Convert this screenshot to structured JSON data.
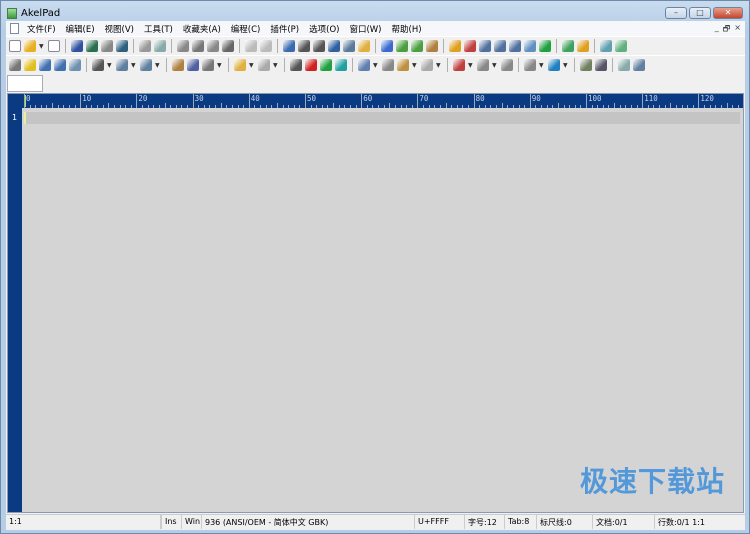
{
  "window": {
    "title": "AkelPad",
    "minimize": "–",
    "maximize": "□",
    "close": "✕"
  },
  "menu": [
    "文件(F)",
    "编辑(E)",
    "视图(V)",
    "工具(T)",
    "收藏夹(A)",
    "编程(C)",
    "插件(P)",
    "选项(O)",
    "窗口(W)",
    "帮助(H)"
  ],
  "mdi": {
    "minimize": "_",
    "restore": "🗗",
    "close": "×"
  },
  "toolbar1": [
    "new-file-icon",
    "open-file-icon|#e8b020",
    "dd",
    "print-preview-icon",
    "sep",
    "save-icon|#3050a0",
    "save-as-icon|#2a7050",
    "save-all-icon|#888",
    "close-file-icon|#306080",
    "sep",
    "print-icon|#999",
    "preview-icon|#8aa",
    "sep",
    "cut-icon|#888",
    "copy-icon|#777",
    "paste-icon|#888",
    "delete-icon|#666",
    "sep",
    "undo-icon|#bbb",
    "redo-icon|#bbb",
    "sep",
    "find-icon|#3a6ab0",
    "find-next-icon|#555",
    "find-prev-icon|#555",
    "replace-icon|#3060a0",
    "goto-icon|#5a7a9a",
    "clipboard-icon|#e0b040",
    "sep",
    "font-icon|#3a6ad0",
    "font-increase-icon|#4aa040",
    "font-decrease-icon|#4aa040",
    "color-icon|#b08040",
    "sep",
    "lock-icon|#e0a020",
    "insert-icon|#c04040",
    "split-icon|#5070a0",
    "split-vertical-icon|#5070a0",
    "split-horizontal-icon|#5070a0",
    "pin-icon|#6090c0",
    "run-icon|#20a040",
    "sep",
    "settings-icon|#40a060",
    "plugin-icon|#e0a020",
    "sep",
    "window-icon|#60a0b0",
    "windows-icon|#60b080"
  ],
  "toolbar2": [
    "sort-icon|#777",
    "bulb-icon|#e0c020",
    "code-icon|#4070b0",
    "refresh-icon|#4070b0",
    "tree-icon|#7090b0",
    "sep",
    "wrap-box-icon|#555",
    "dd",
    "paragraph-icon|#6080a0",
    "dd",
    "view-box-icon|#6080a0",
    "dd",
    "sep",
    "copy-doc-icon|#b08040",
    "save-doc-icon|#5060a0",
    "zoom-icon|#777",
    "dd",
    "sep",
    "folder-icon|#e0b040",
    "dd",
    "layout-icon|#aaa",
    "dd",
    "sep",
    "record-icon|#555",
    "stop-icon|#d02020",
    "play-icon|#20a040",
    "play-all-icon|#20a0a0",
    "sep",
    "script-icon|#6080b0",
    "dd",
    "compare-icon|#888",
    "doc-lock-icon|#c09040",
    "dd",
    "page-icon|#aaa",
    "dd",
    "sep",
    "sort-az-icon|#c04040",
    "dd",
    "clip-icon|#888",
    "dd",
    "text-icon|#888",
    "sep",
    "keyboard-icon|#888",
    "dd",
    "panel-icon|#2080c0",
    "dd",
    "sep",
    "note-icon|#708060",
    "shield-icon|#556",
    "sep",
    "blank-doc-icon|#8aa",
    "fullscreen-icon|#6080a0"
  ],
  "ruler": {
    "labels": [
      "0",
      "10",
      "20",
      "30",
      "40",
      "50",
      "60",
      "70",
      "80",
      "90",
      "100",
      "110",
      "120"
    ]
  },
  "editor": {
    "line_number": "1"
  },
  "status": {
    "position": "1:1",
    "empty": "",
    "insert_mode": "Ins",
    "newline": "Win",
    "codepage": "936  (ANSI/OEM - 简体中文 GBK)",
    "char_code": "U+FFFF",
    "font_size": "字号:12",
    "tab_size": "Tab:8",
    "ruler": "标尺线:0",
    "documents": "文档:0/1",
    "lines": "行数:0/1 1:1"
  },
  "watermark": "极速下载站"
}
